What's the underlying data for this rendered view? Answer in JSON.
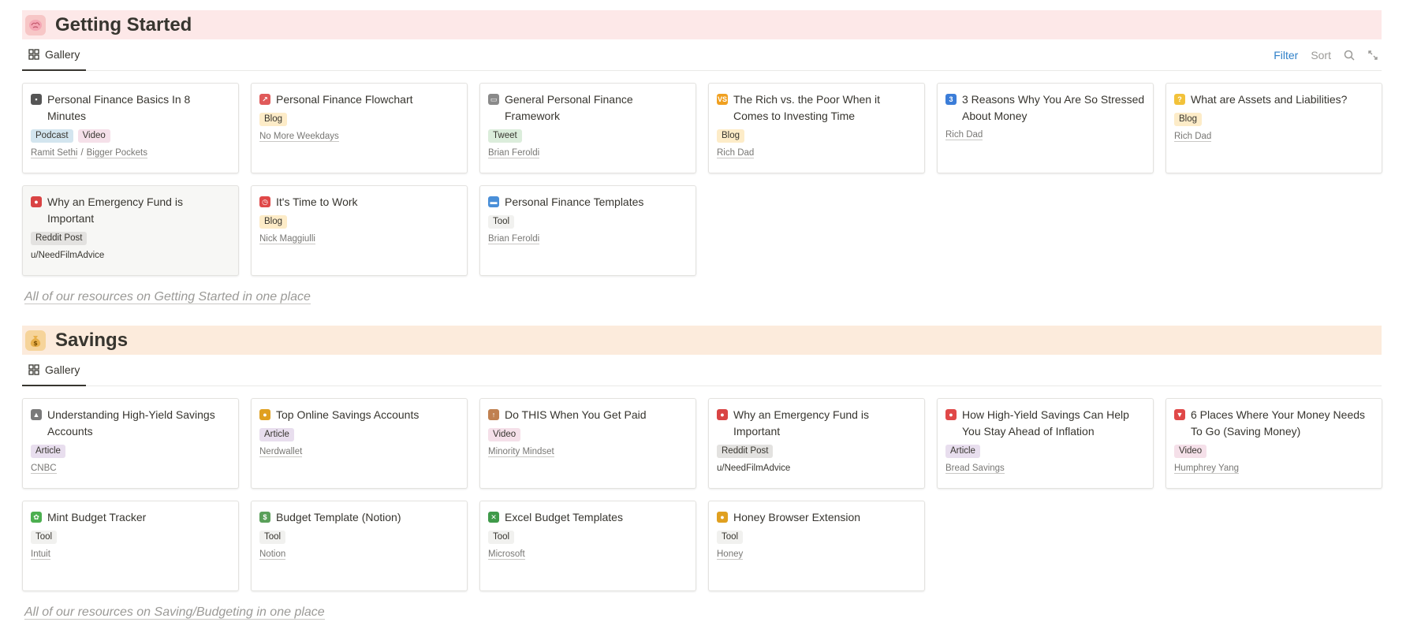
{
  "sections": [
    {
      "title": "Getting Started",
      "icon": "brain-icon",
      "header_color": "#fde8e8",
      "tab": "Gallery",
      "tools": {
        "filter": "Filter",
        "sort": "Sort"
      },
      "footer": "All of our resources on Getting Started in one place",
      "cards": [
        {
          "title": "Personal Finance Basics In 8 Minutes",
          "icon": "film-projector-icon",
          "tags": [
            "Podcast",
            "Video"
          ],
          "sources": [
            "Ramit Sethi",
            "Bigger Pockets"
          ],
          "source_sep": "/"
        },
        {
          "title": "Personal Finance Flowchart",
          "icon": "chart-increasing-icon",
          "tags": [
            "Blog"
          ],
          "sources": [
            "No More Weekdays"
          ]
        },
        {
          "title": "General Personal Finance Framework",
          "icon": "id-card-icon",
          "tags": [
            "Tweet"
          ],
          "sources": [
            "Brian Feroldi"
          ]
        },
        {
          "title": "The Rich vs. the Poor When it Comes to Investing Time",
          "icon": "vs-icon",
          "tags": [
            "Blog"
          ],
          "sources": [
            "Rich Dad"
          ]
        },
        {
          "title": "3 Reasons Why You Are So Stressed About Money",
          "icon": "keycap-three-icon",
          "tags": [],
          "sources": [
            "Rich Dad"
          ]
        },
        {
          "title": "What are Assets and Liabilities?",
          "icon": "thinking-face-icon",
          "tags": [
            "Blog"
          ],
          "sources": [
            "Rich Dad"
          ]
        },
        {
          "title": "Why an Emergency Fund is Important",
          "icon": "police-light-icon",
          "tags": [
            "Reddit Post"
          ],
          "sources": [
            "u/NeedFilmAdvice"
          ],
          "plain_source": true
        },
        {
          "title": "It's Time to Work",
          "icon": "alarm-clock-icon",
          "tags": [
            "Blog"
          ],
          "sources": [
            "Nick Maggiulli"
          ]
        },
        {
          "title": "Personal Finance Templates",
          "icon": "folder-icon",
          "tags": [
            "Tool"
          ],
          "sources": [
            "Brian Feroldi"
          ]
        }
      ]
    },
    {
      "title": "Savings",
      "icon": "money-bag-icon",
      "header_color": "#fcebdc",
      "tab": "Gallery",
      "footer": "All of our resources on Saving/Budgeting in one place",
      "cards": [
        {
          "title": "Understanding High-Yield Savings Accounts",
          "icon": "bank-icon",
          "tags": [
            "Article"
          ],
          "sources": [
            "CNBC"
          ]
        },
        {
          "title": "Top Online Savings Accounts",
          "icon": "medal-icon",
          "tags": [
            "Article"
          ],
          "sources": [
            "Nerdwallet"
          ]
        },
        {
          "title": "Do THIS When You Get Paid",
          "icon": "person-walking-icon",
          "tags": [
            "Video"
          ],
          "sources": [
            "Minority Mindset"
          ]
        },
        {
          "title": "Why an Emergency Fund is Important",
          "icon": "police-light-icon",
          "tags": [
            "Reddit Post"
          ],
          "sources": [
            "u/NeedFilmAdvice"
          ],
          "plain_source": true
        },
        {
          "title": "How High-Yield Savings Can Help You Stay Ahead of Inflation",
          "icon": "round-pushpin-icon",
          "tags": [
            "Article"
          ],
          "sources": [
            "Bread Savings"
          ]
        },
        {
          "title": "6 Places Where Your Money Needs To Go (Saving Money)",
          "icon": "pushpin-icon",
          "tags": [
            "Video"
          ],
          "sources": [
            "Humphrey Yang"
          ]
        },
        {
          "title": "Mint Budget Tracker",
          "icon": "leaf-icon",
          "tags": [
            "Tool"
          ],
          "sources": [
            "Intuit"
          ]
        },
        {
          "title": "Budget Template (Notion)",
          "icon": "dollar-banknote-icon",
          "tags": [
            "Tool"
          ],
          "sources": [
            "Notion"
          ]
        },
        {
          "title": "Excel Budget Templates",
          "icon": "cross-mark-button-icon",
          "tags": [
            "Tool"
          ],
          "sources": [
            "Microsoft"
          ]
        },
        {
          "title": "Honey Browser Extension",
          "icon": "honey-pot-icon",
          "tags": [
            "Tool"
          ],
          "sources": [
            "Honey"
          ]
        }
      ]
    }
  ]
}
